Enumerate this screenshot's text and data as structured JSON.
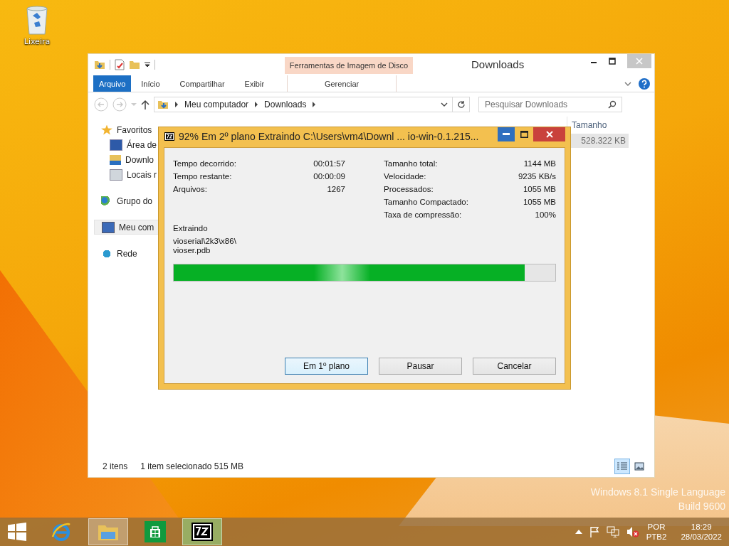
{
  "desktop": {
    "icons": [
      {
        "label": "Lixeira"
      }
    ],
    "os_edition": [
      "Windows 8.1 Single Language",
      "Build 9600"
    ]
  },
  "explorer": {
    "title": "Downloads",
    "contextual_group": "Ferramentas de Imagem de Disco",
    "ribbon_tabs": [
      {
        "label": "Arquivo",
        "kind": "file",
        "selected": false
      },
      {
        "label": "Início",
        "kind": "tab",
        "selected": false
      },
      {
        "label": "Compartilhar",
        "kind": "tab",
        "selected": false
      },
      {
        "label": "Exibir",
        "kind": "tab",
        "selected": false
      },
      {
        "label": "Gerenciar",
        "kind": "contextual",
        "selected": false
      }
    ],
    "breadcrumbs": [
      "Meu computador",
      "Downloads"
    ],
    "search": {
      "placeholder": "Pesquisar Downloads"
    },
    "nav_pane": [
      {
        "label": "Favoritos",
        "kind": "favorites",
        "selected": false,
        "children": [
          {
            "label": "Área de",
            "kind": "desktop",
            "selected": false
          },
          {
            "label": "Downlo",
            "kind": "downloads",
            "selected": false
          },
          {
            "label": "Locais r",
            "kind": "recent",
            "selected": false
          }
        ]
      },
      {
        "label": "Grupo do",
        "kind": "homegroup",
        "selected": false
      },
      {
        "label": "Meu com",
        "kind": "computer",
        "selected": true
      },
      {
        "label": "Rede",
        "kind": "network",
        "selected": false
      }
    ],
    "column_header": "Tamanho",
    "file_size_cell": "528.322 KB",
    "status_bar": {
      "items": "2 itens",
      "selection": "1 item selecionado  515 MB"
    },
    "view_buttons": [
      {
        "kind": "details",
        "selected": true
      },
      {
        "kind": "thumbnails",
        "selected": false
      }
    ]
  },
  "dialog": {
    "title": "92% Em 2º plano Extraindo C:\\Users\\vm4\\Downl ... io-win-0.1.215...",
    "stats_left": [
      {
        "label": "Tempo decorrido:",
        "value": "00:01:57"
      },
      {
        "label": "Tempo restante:",
        "value": "00:00:09"
      },
      {
        "label": "Arquivos:",
        "value": "1267"
      }
    ],
    "stats_right": [
      {
        "label": "Tamanho total:",
        "value": "1144 MB"
      },
      {
        "label": "Velocidade:",
        "value": "9235 KB/s"
      },
      {
        "label": "Processados:",
        "value": "1055 MB"
      },
      {
        "label": "Tamanho Compactado:",
        "value": "1055 MB"
      },
      {
        "label": "Taxa de compressão:",
        "value": "100%"
      }
    ],
    "action": "Extraindo",
    "current_file": [
      "vioserial\\2k3\\x86\\",
      "vioser.pdb"
    ],
    "progress": {
      "level": 0.92
    },
    "buttons": [
      "Em 1º plano",
      "Pausar",
      "Cancelar"
    ]
  },
  "taskbar": {
    "items": [
      {
        "kind": "start",
        "active": false
      },
      {
        "kind": "browser",
        "active": false
      },
      {
        "kind": "files",
        "active": true
      },
      {
        "kind": "store",
        "active": false
      },
      {
        "kind": "archiver",
        "active": true
      }
    ],
    "language": [
      "POR",
      "PTB2"
    ],
    "time": "18:29",
    "date": "28/03/2022"
  }
}
